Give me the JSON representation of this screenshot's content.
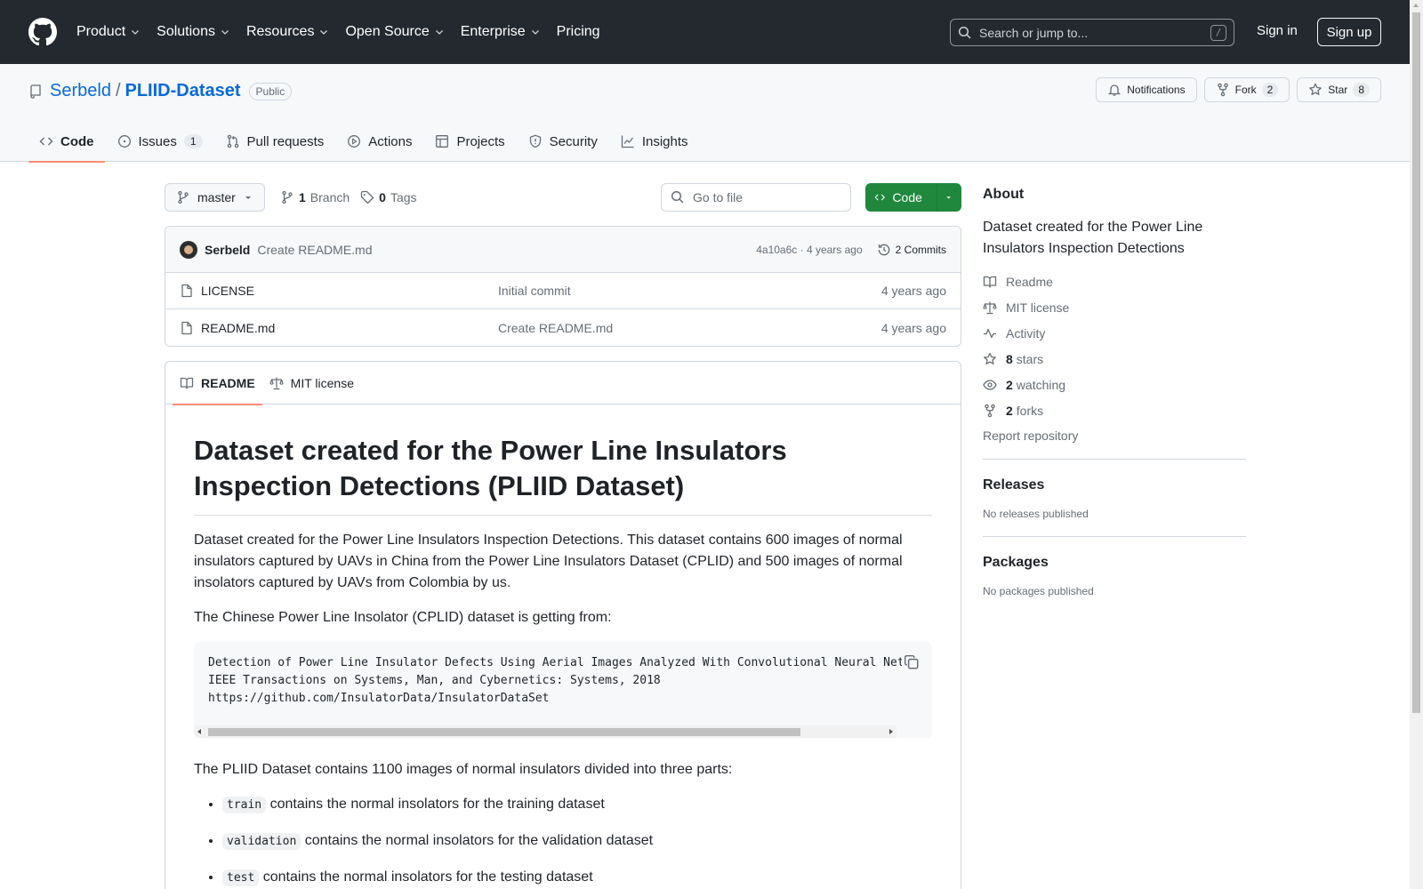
{
  "header": {
    "nav": [
      "Product",
      "Solutions",
      "Resources",
      "Open Source",
      "Enterprise",
      "Pricing"
    ],
    "search_placeholder": "Search or jump to...",
    "search_shortcut": "/",
    "signin": "Sign in",
    "signup": "Sign up"
  },
  "repo": {
    "owner": "Serbeld",
    "separator": "/",
    "name": "PLIID-Dataset",
    "visibility": "Public",
    "actions": {
      "notifications": "Notifications",
      "fork": "Fork",
      "fork_count": "2",
      "star": "Star",
      "star_count": "8"
    },
    "tabs": {
      "code": "Code",
      "issues": "Issues",
      "issues_count": "1",
      "pulls": "Pull requests",
      "actions": "Actions",
      "projects": "Projects",
      "security": "Security",
      "insights": "Insights"
    }
  },
  "toolbar": {
    "branch": "master",
    "branches_count": "1",
    "branches_label": "Branch",
    "tags_count": "0",
    "tags_label": "Tags",
    "goto_placeholder": "Go to file",
    "code_button": "Code"
  },
  "commit": {
    "author": "Serbeld",
    "message": "Create README.md",
    "hash_age": "4a10a6c · 4 years ago",
    "commits": "2 Commits"
  },
  "files": [
    {
      "name": "LICENSE",
      "message": "Initial commit",
      "age": "4 years ago"
    },
    {
      "name": "README.md",
      "message": "Create README.md",
      "age": "4 years ago"
    }
  ],
  "readme": {
    "tab_readme": "README",
    "tab_license": "MIT license",
    "title": "Dataset created for the Power Line Insulators Inspection Detections (PLIID Dataset)",
    "p1": "Dataset created for the Power Line Insulators Inspection Detections. This dataset contains 600 images of normal insulators captured by UAVs in China from the Power Line Insulators Dataset (CPLID) and 500 images of normal insolators captured by UAVs from Colombia by us.",
    "p2": "The Chinese Power Line Insolator (CPLID) dataset is getting from:",
    "code": "Detection of Power Line Insulator Defects Using Aerial Images Analyzed With Convolutional Neural Networks\nIEEE Transactions on Systems, Man, and Cybernetics: Systems, 2018\nhttps://github.com/InsulatorData/InsulatorDataSet",
    "p3": "The PLIID Dataset contains 1100 images of normal insulators divided into three parts:",
    "list": [
      {
        "code": "train",
        "text": " contains the normal insolators for the training dataset"
      },
      {
        "code": "validation",
        "text": " contains the normal insolators for the validation dataset"
      },
      {
        "code": "test",
        "text": " contains the normal insolators for the testing dataset"
      }
    ]
  },
  "sidebar": {
    "about_title": "About",
    "description": "Dataset created for the Power Line Insulators Inspection Detections",
    "readme": "Readme",
    "license": "MIT license",
    "activity": "Activity",
    "stars_count": "8",
    "stars_label": "stars",
    "watching_count": "2",
    "watching_label": "watching",
    "forks_count": "2",
    "forks_label": "forks",
    "report": "Report repository",
    "releases_title": "Releases",
    "releases_empty": "No releases published",
    "packages_title": "Packages",
    "packages_empty": "No packages published"
  }
}
